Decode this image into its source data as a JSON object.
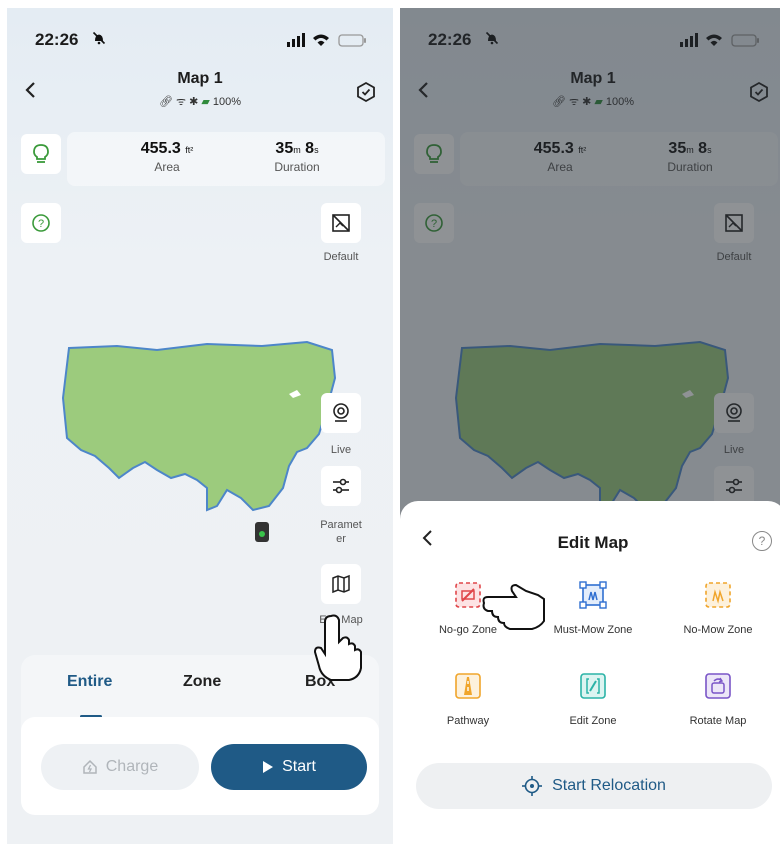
{
  "status_bar": {
    "time": "22:26"
  },
  "header": {
    "title": "Map 1",
    "battery": "100%"
  },
  "stats": {
    "area_value": "455.3",
    "area_unit": "ft²",
    "area_label": "Area",
    "duration_min": "35",
    "duration_min_unit": "m",
    "duration_sec": "8",
    "duration_sec_unit": "s",
    "duration_label": "Duration"
  },
  "side_buttons": {
    "default_label": "Default",
    "live_label": "Live",
    "parameter_label_line1": "Paramet",
    "parameter_label_line2": "er",
    "edit_map_label": "Edit Map"
  },
  "mode_tabs": [
    "Entire",
    "Zone",
    "Box"
  ],
  "actions": {
    "charge": "Charge",
    "start": "Start"
  },
  "edit_sheet": {
    "title": "Edit Map",
    "help": "?",
    "tools": [
      "No-go Zone",
      "Must-Mow Zone",
      "No-Mow Zone",
      "Pathway",
      "Edit Zone",
      "Rotate Map"
    ],
    "relocation": "Start Relocation"
  },
  "colors": {
    "accent": "#1f5a86",
    "map_fill": "#9ccb7d",
    "map_border": "#4d86c9",
    "green_icon": "#3a9a3a",
    "no_go": "#e0464a",
    "must_mow": "#2f6fd1",
    "no_mow": "#f0a52b",
    "pathway": "#f0a52b",
    "edit_zone": "#2bb3a7",
    "rotate": "#7a55c7"
  }
}
